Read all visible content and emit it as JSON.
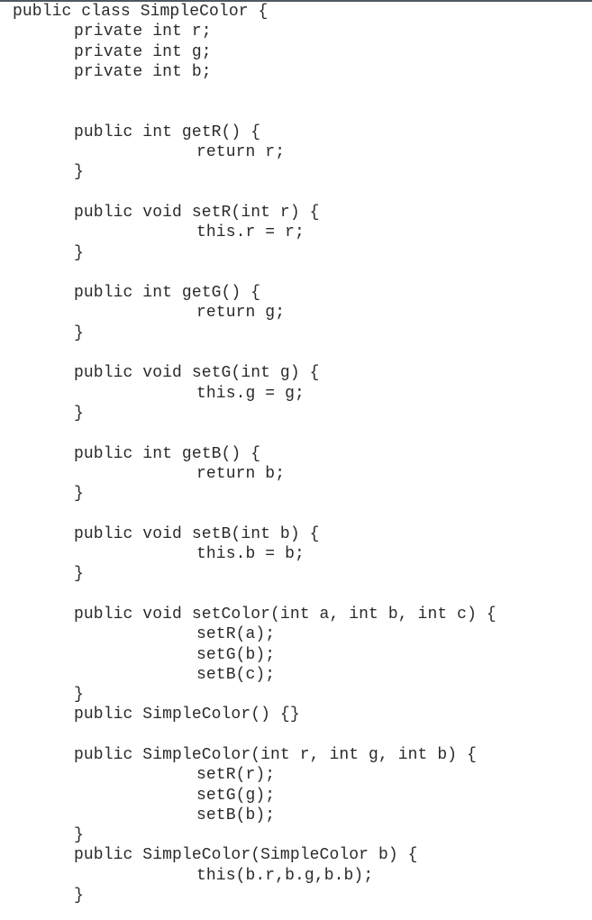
{
  "document": {
    "type": "java-source-snippet",
    "class_name": "SimpleColor",
    "lines": [
      {
        "indent": 0,
        "text": "public class SimpleColor {"
      },
      {
        "indent": 1,
        "text": "private int r;"
      },
      {
        "indent": 1,
        "text": "private int g;"
      },
      {
        "indent": 1,
        "text": "private int b;"
      },
      {
        "indent": 0,
        "text": ""
      },
      {
        "indent": 0,
        "text": ""
      },
      {
        "indent": 1,
        "text": "public int getR() {"
      },
      {
        "indent": 2,
        "text": "return r;"
      },
      {
        "indent": 1,
        "text": "}"
      },
      {
        "indent": 0,
        "text": ""
      },
      {
        "indent": 1,
        "text": "public void setR(int r) {"
      },
      {
        "indent": 2,
        "text": "this.r = r;"
      },
      {
        "indent": 1,
        "text": "}"
      },
      {
        "indent": 0,
        "text": ""
      },
      {
        "indent": 1,
        "text": "public int getG() {"
      },
      {
        "indent": 2,
        "text": "return g;"
      },
      {
        "indent": 1,
        "text": "}"
      },
      {
        "indent": 0,
        "text": ""
      },
      {
        "indent": 1,
        "text": "public void setG(int g) {"
      },
      {
        "indent": 2,
        "text": "this.g = g;"
      },
      {
        "indent": 1,
        "text": "}"
      },
      {
        "indent": 0,
        "text": ""
      },
      {
        "indent": 1,
        "text": "public int getB() {"
      },
      {
        "indent": 2,
        "text": "return b;"
      },
      {
        "indent": 1,
        "text": "}"
      },
      {
        "indent": 0,
        "text": ""
      },
      {
        "indent": 1,
        "text": "public void setB(int b) {"
      },
      {
        "indent": 2,
        "text": "this.b = b;"
      },
      {
        "indent": 1,
        "text": "}"
      },
      {
        "indent": 0,
        "text": ""
      },
      {
        "indent": 1,
        "text": "public void setColor(int a, int b, int c) {"
      },
      {
        "indent": 2,
        "text": "setR(a);"
      },
      {
        "indent": 2,
        "text": "setG(b);"
      },
      {
        "indent": 2,
        "text": "setB(c);"
      },
      {
        "indent": 1,
        "text": "}"
      },
      {
        "indent": 1,
        "text": "public SimpleColor() {}"
      },
      {
        "indent": 0,
        "text": ""
      },
      {
        "indent": 1,
        "text": "public SimpleColor(int r, int g, int b) {"
      },
      {
        "indent": 2,
        "text": "setR(r);"
      },
      {
        "indent": 2,
        "text": "setG(g);"
      },
      {
        "indent": 2,
        "text": "setB(b);"
      },
      {
        "indent": 1,
        "text": "}"
      },
      {
        "indent": 1,
        "text": "public SimpleColor(SimpleColor b) {"
      },
      {
        "indent": 2,
        "text": "this(b.r,b.g,b.b);"
      },
      {
        "indent": 1,
        "text": "}"
      }
    ]
  },
  "colors": {
    "text": "#2a2a2a",
    "background": "#ffffff",
    "top_border": "#4d5a63"
  }
}
